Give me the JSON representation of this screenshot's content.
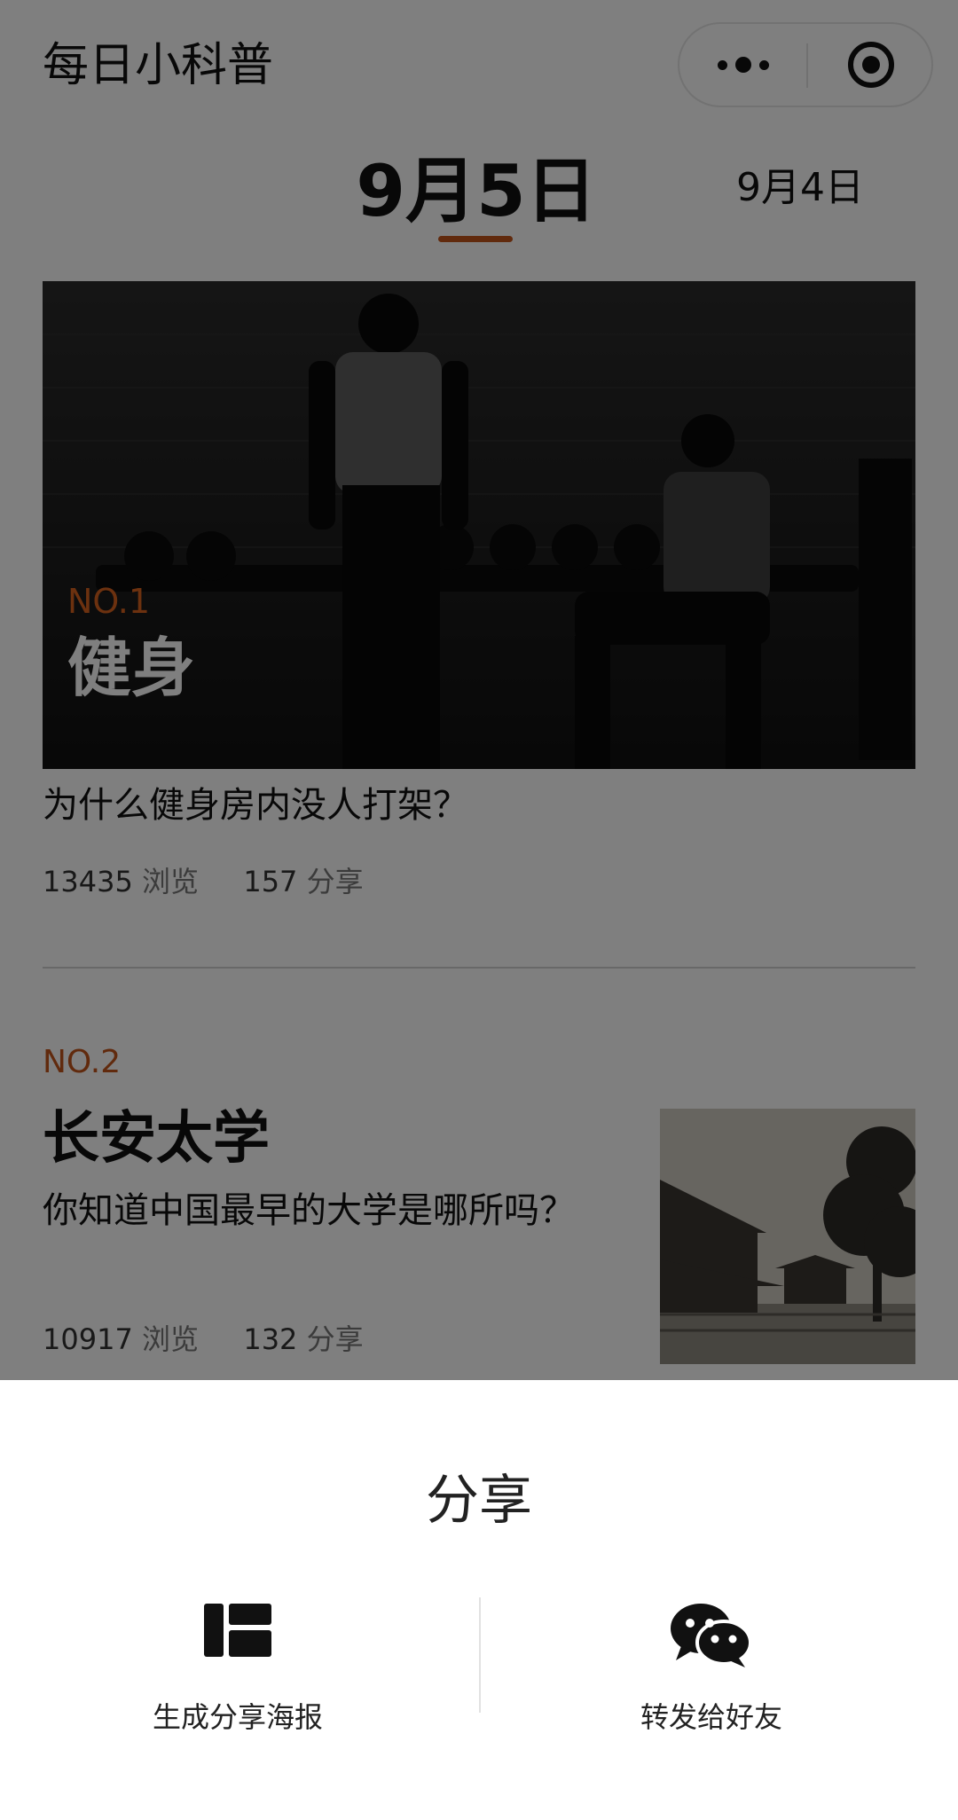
{
  "navbar": {
    "title": "每日小科普",
    "more_icon": "more-dots-icon",
    "close_icon": "target-close-icon"
  },
  "date_tabs": {
    "active": "9月5日",
    "next": "9月4日",
    "accent_color": "#c2551b"
  },
  "articles": [
    {
      "rank": "NO.1",
      "topic": "健身",
      "title": "为什么健身房内没人打架？",
      "views": "13435",
      "views_label": "浏览",
      "shares": "157",
      "shares_label": "分享"
    },
    {
      "rank": "NO.2",
      "topic": "长安太学",
      "title": "你知道中国最早的大学是哪所吗？",
      "views": "10917",
      "views_label": "浏览",
      "shares": "132",
      "shares_label": "分享"
    }
  ],
  "share_sheet": {
    "title": "分享",
    "options": [
      {
        "label": "生成分享海报",
        "icon": "poster-layout-icon"
      },
      {
        "label": "转发给好友",
        "icon": "wechat-icon"
      }
    ]
  }
}
